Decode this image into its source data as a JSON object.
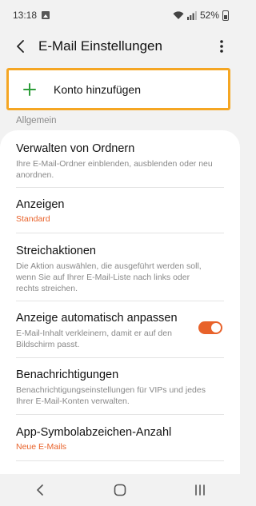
{
  "status_bar": {
    "time": "13:18",
    "battery_percent": "52%",
    "icons": [
      "gallery-icon",
      "wifi-icon",
      "signal-icon",
      "battery-icon"
    ]
  },
  "app_bar": {
    "title": "E-Mail Einstellungen",
    "back_icon": "back-arrow-icon",
    "more_icon": "more-vertical-icon"
  },
  "add_account": {
    "label": "Konto hinzufügen",
    "icon": "plus-icon",
    "highlight_color": "#f5a623",
    "icon_color": "#2e9e3a"
  },
  "section": {
    "header": "Allgemein"
  },
  "items": [
    {
      "title": "Verwalten von Ordnern",
      "desc_line1": "Ihre E-Mail-Ordner einblenden, ausblenden oder neu",
      "desc_line2": "anordnen."
    },
    {
      "title": "Anzeigen",
      "value": "Standard"
    },
    {
      "title": "Streichaktionen",
      "desc_line1": "Die Aktion auswählen, die ausgeführt werden soll,",
      "desc_line2": "wenn Sie auf Ihrer E-Mail-Liste nach links oder",
      "desc_line3": "rechts streichen."
    },
    {
      "title": "Anzeige automatisch anpassen",
      "desc_line1": "E-Mail-Inhalt verkleinern, damit er auf den",
      "desc_line2": "Bildschirm passt.",
      "toggle_on": true
    },
    {
      "title": "Benachrichtigungen",
      "desc_line1": "Benachrichtigungseinstellungen für VIPs und jedes",
      "desc_line2": "Ihrer E-Mail-Konten verwalten."
    },
    {
      "title": "App-Symbolabzeichen-Anzahl",
      "value": "Neue E-Mails"
    }
  ],
  "colors": {
    "accent": "#e8622a",
    "background": "#f2f2f2",
    "card": "#ffffff"
  },
  "nav_bar": {
    "icons": [
      "recents-back-icon",
      "home-icon",
      "recent-apps-icon"
    ]
  }
}
